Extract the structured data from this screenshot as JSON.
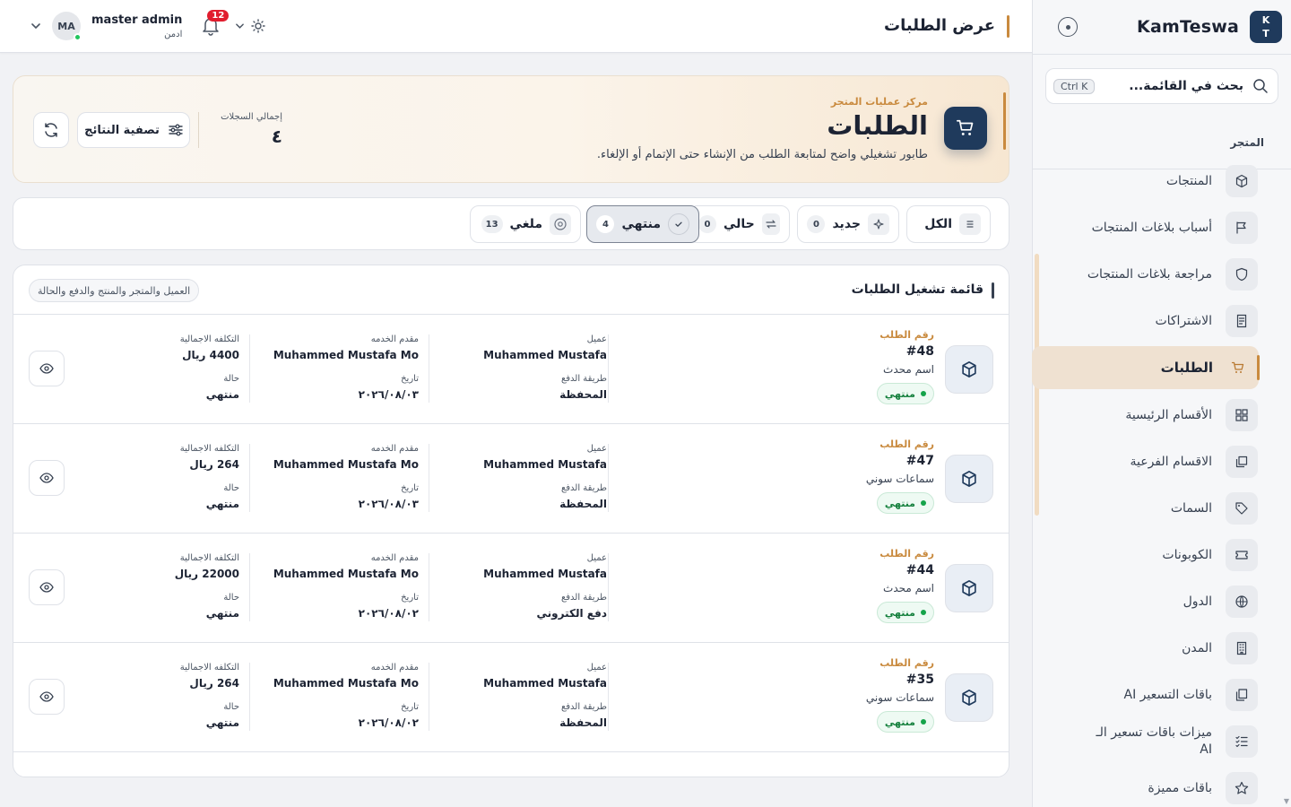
{
  "topbar": {
    "page_title": "عرض الطلبات",
    "user_name": "master admin",
    "user_role": "ادمن",
    "avatar_initials": "MA",
    "notifications_count": "12",
    "icons": [
      "chevron-down-icon",
      "bell-icon",
      "sun-icon"
    ]
  },
  "sidebar": {
    "brand": "KamTeswa",
    "logo_line1": "K",
    "logo_line2": "T",
    "search_placeholder": "بحث في القائمة...",
    "search_shortcut": "Ctrl K",
    "section_title": "المتجر",
    "items": [
      {
        "label": "المنتجات",
        "icon": "cube-icon"
      },
      {
        "label": "أسباب بلاغات المنتجات",
        "icon": "flag-icon"
      },
      {
        "label": "مراجعة بلاغات المنتجات",
        "icon": "shield-icon"
      },
      {
        "label": "الاشتراكات",
        "icon": "receipt-icon"
      },
      {
        "label": "الطلبات",
        "icon": "cart-icon",
        "active": true
      },
      {
        "label": "الأقسام الرئيسية",
        "icon": "grid-icon"
      },
      {
        "label": "الاقسام الفرعية",
        "icon": "layers-icon"
      },
      {
        "label": "السمات",
        "icon": "tag-icon"
      },
      {
        "label": "الكوبونات",
        "icon": "ticket-icon"
      },
      {
        "label": "الدول",
        "icon": "globe-icon"
      },
      {
        "label": "المدن",
        "icon": "building-icon"
      },
      {
        "label": "باقات التسعير AI",
        "icon": "copy-icon"
      },
      {
        "label": "ميزات باقات تسعير الـ AI",
        "icon": "checklist-icon"
      },
      {
        "label": "باقات مميزة",
        "icon": "star-icon"
      }
    ]
  },
  "hero": {
    "kicker": "مركز عمليات المتجر",
    "title": "الطلبات",
    "subtitle": "طابور تشغيلي واضح لمتابعة الطلب من الإنشاء حتى الإتمام أو الإلغاء.",
    "total_label": "إجمالي السجلات",
    "total_value": "٤",
    "filter_button": "تصفية النتائج"
  },
  "tabs": [
    {
      "label": "الكل",
      "count": "",
      "icon": "list-icon"
    },
    {
      "label": "جديد",
      "count": "0",
      "icon": "sparkle-icon"
    },
    {
      "label": "حالي",
      "count": "0",
      "icon": "repeat-icon"
    },
    {
      "label": "منتهي",
      "count": "4",
      "icon": "check-circle-icon",
      "active": true
    },
    {
      "label": "ملغي",
      "count": "13",
      "icon": "x-circle-icon"
    }
  ],
  "list": {
    "title": "قائمة تشغيل الطلبات",
    "chip": "العميل والمتجر والمنتج والدفع والحالة",
    "labels": {
      "order_number": "رقم الطلب",
      "client": "عميل",
      "provider": "مقدم الخدمه",
      "total": "التكلفه الاجمالية",
      "payment": "طريقة الدفع",
      "date": "تاريخ",
      "status": "حالة"
    },
    "orders": [
      {
        "number": "#48",
        "product": "اسم محدث",
        "badge": "منتهي",
        "client": "Muhammed Mustafa",
        "provider": "Muhammed Mustafa Mo",
        "total": "4400 ريال",
        "payment": "المحفظة",
        "date": "٢٠٢٦/٠٨/٠٣",
        "status": "منتهي"
      },
      {
        "number": "#47",
        "product": "سماعات سوني",
        "badge": "منتهي",
        "client": "Muhammed Mustafa",
        "provider": "Muhammed Mustafa Mo",
        "total": "264 ريال",
        "payment": "المحفظة",
        "date": "٢٠٢٦/٠٨/٠٣",
        "status": "منتهي"
      },
      {
        "number": "#44",
        "product": "اسم محدث",
        "badge": "منتهي",
        "client": "Muhammed Mustafa",
        "provider": "Muhammed Mustafa Mo",
        "total": "22000 ريال",
        "payment": "دفع الكتروني",
        "date": "٢٠٢٦/٠٨/٠٢",
        "status": "منتهي"
      },
      {
        "number": "#35",
        "product": "سماعات سوني",
        "badge": "منتهي",
        "client": "Muhammed Mustafa",
        "provider": "Muhammed Mustafa Mo",
        "total": "264 ريال",
        "payment": "المحفظة",
        "date": "٢٠٢٦/٠٨/٠٢",
        "status": "منتهي"
      }
    ]
  },
  "colors": {
    "accent": "#c98a3e",
    "brand_navy": "#1f3a5c",
    "success": "#15803d"
  }
}
